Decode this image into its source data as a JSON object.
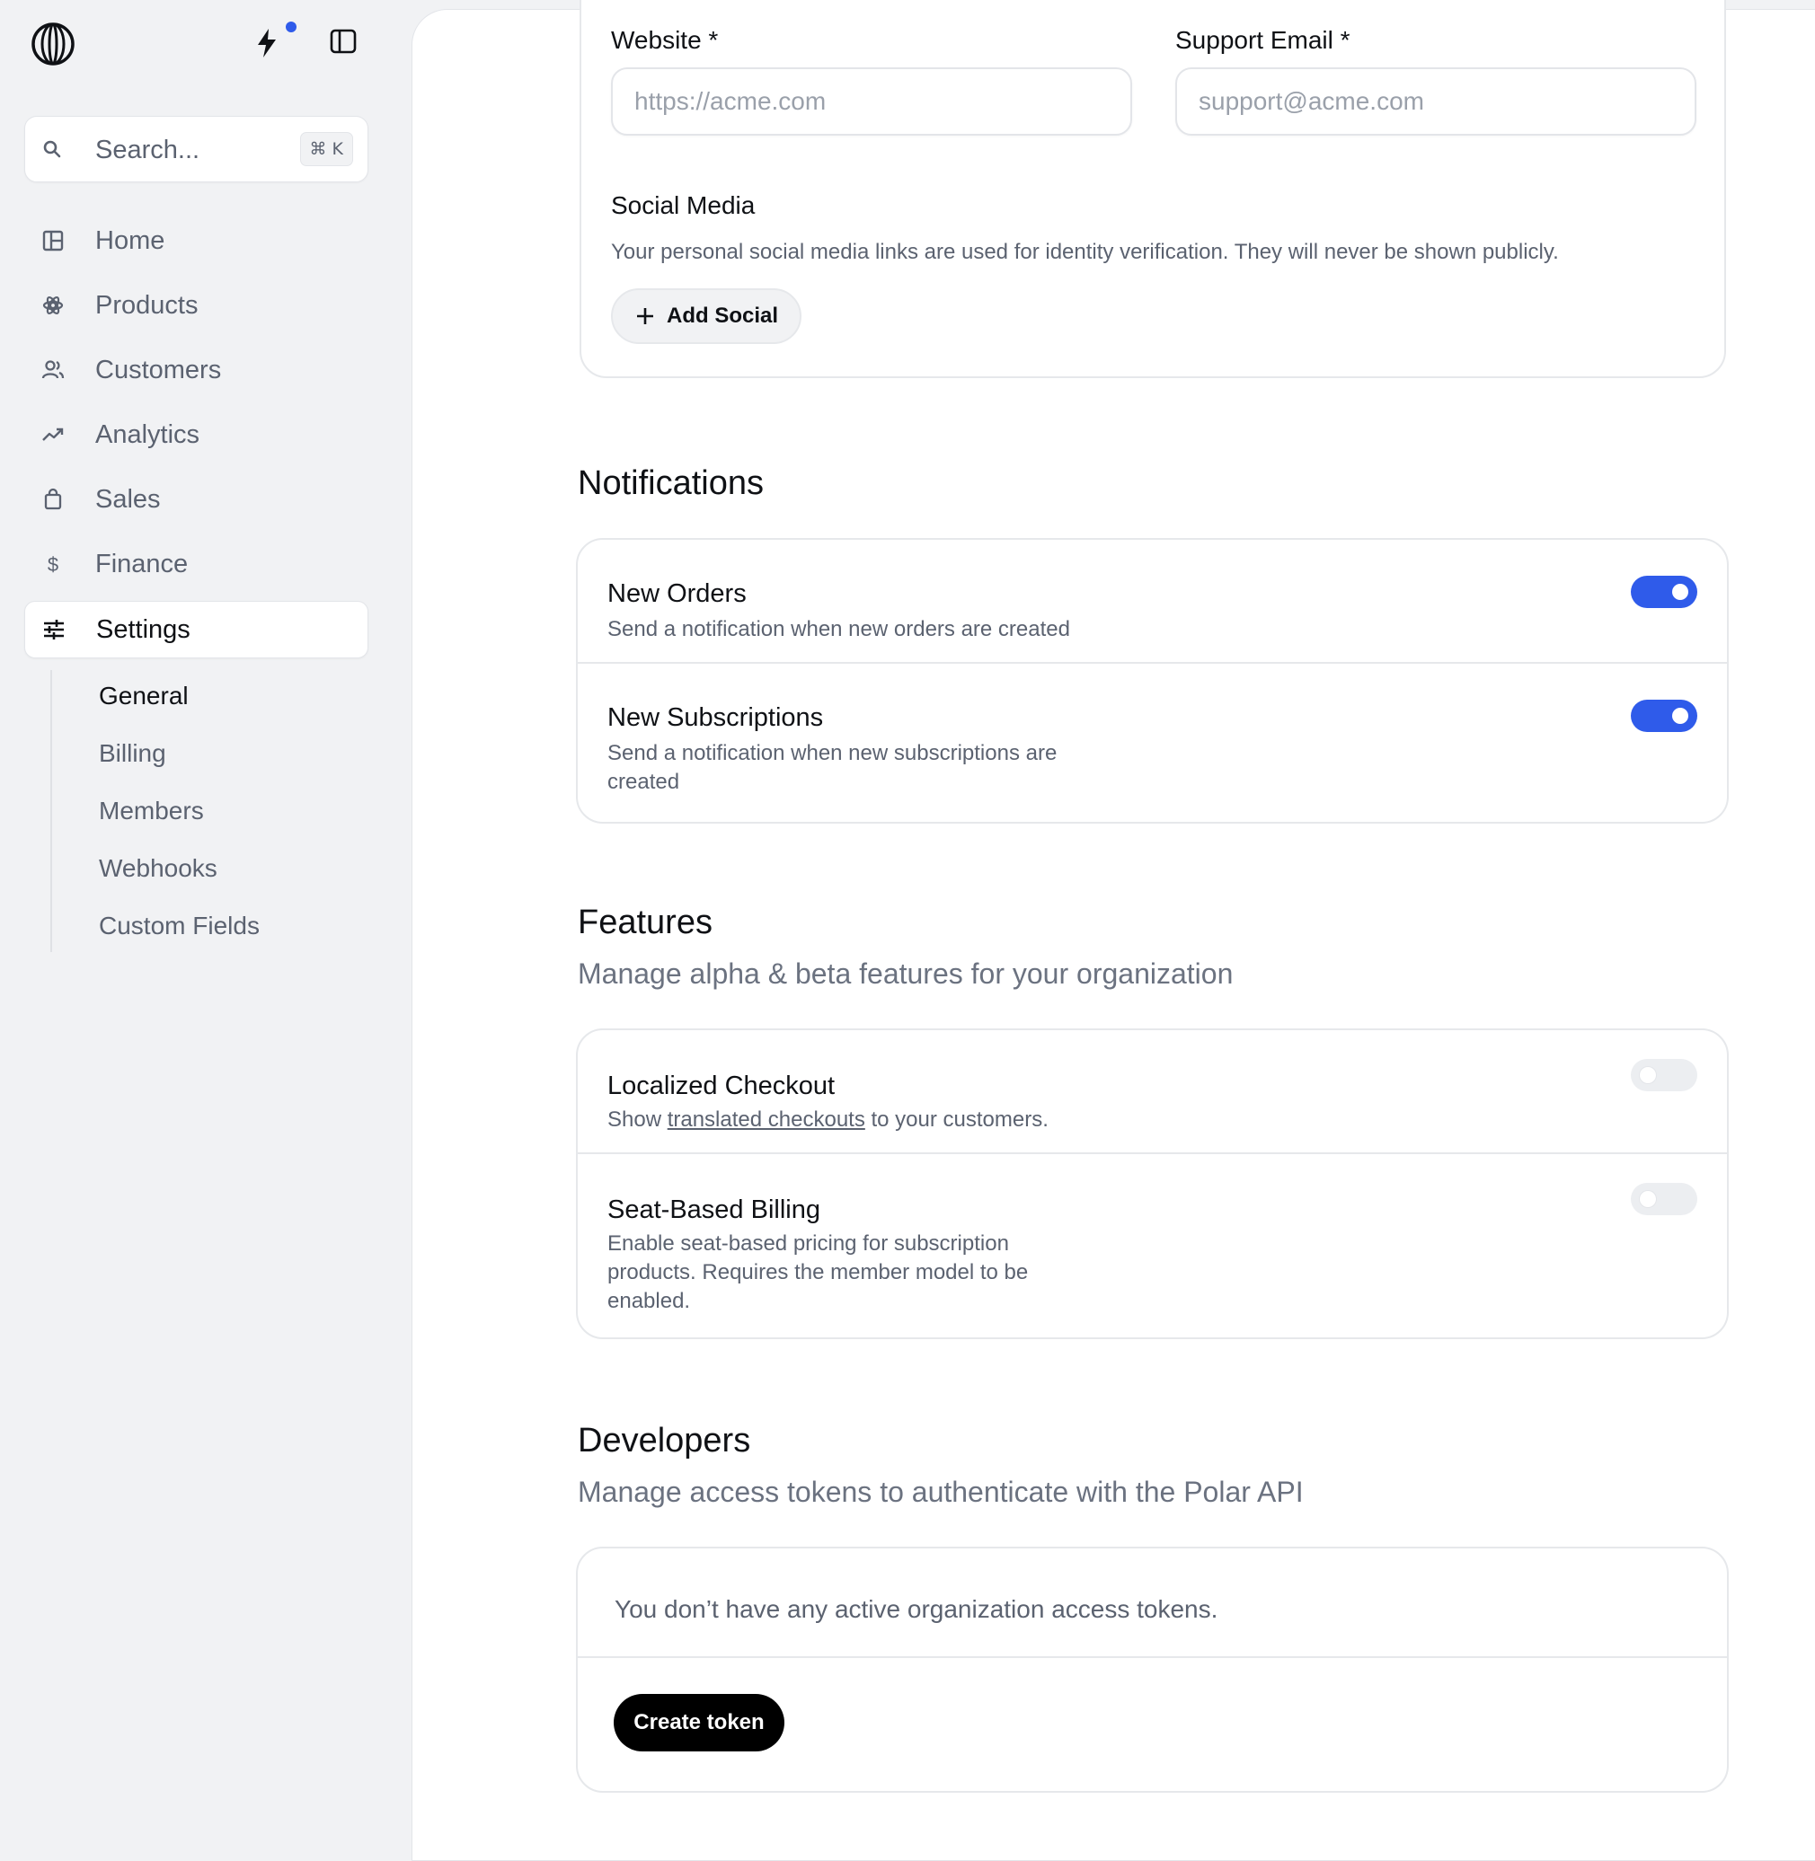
{
  "sidebar": {
    "search": {
      "placeholder": "Search...",
      "shortcut": "⌘ K"
    },
    "nav": [
      {
        "label": "Home",
        "icon": "home-icon"
      },
      {
        "label": "Products",
        "icon": "products-icon"
      },
      {
        "label": "Customers",
        "icon": "customers-icon"
      },
      {
        "label": "Analytics",
        "icon": "analytics-icon"
      },
      {
        "label": "Sales",
        "icon": "sales-icon"
      },
      {
        "label": "Finance",
        "icon": "finance-icon"
      },
      {
        "label": "Settings",
        "icon": "settings-icon",
        "active": true
      }
    ],
    "settings_subnav": [
      {
        "label": "General",
        "active": true
      },
      {
        "label": "Billing"
      },
      {
        "label": "Members"
      },
      {
        "label": "Webhooks"
      },
      {
        "label": "Custom Fields"
      }
    ],
    "notification_dot_color": "#2f5bea"
  },
  "profile": {
    "website_label": "Website *",
    "website_placeholder": "https://acme.com",
    "support_email_label": "Support Email *",
    "support_email_placeholder": "support@acme.com",
    "social_title": "Social Media",
    "social_description": "Your personal social media links are used for identity verification. They will never be shown publicly.",
    "add_social_label": "Add Social"
  },
  "notifications": {
    "title": "Notifications",
    "items": [
      {
        "title": "New Orders",
        "description": "Send a notification when new orders are created",
        "enabled": true
      },
      {
        "title": "New Subscriptions",
        "description": "Send a notification when new subscriptions are created",
        "enabled": true
      }
    ]
  },
  "features": {
    "title": "Features",
    "subtitle": "Manage alpha & beta features for your organization",
    "items": [
      {
        "title": "Localized Checkout",
        "description_prefix": "Show ",
        "description_link": "translated checkouts",
        "description_suffix": " to your customers.",
        "enabled": false
      },
      {
        "title": "Seat-Based Billing",
        "description": "Enable seat-based pricing for subscription products. Requires the member model to be enabled.",
        "enabled": false
      }
    ]
  },
  "developers": {
    "title": "Developers",
    "subtitle": "Manage access tokens to authenticate with the Polar API",
    "empty_state": "You don’t have any active organization access tokens.",
    "create_token_label": "Create token"
  },
  "colors": {
    "accent": "#2f5bea",
    "primary_button": "#000000"
  }
}
